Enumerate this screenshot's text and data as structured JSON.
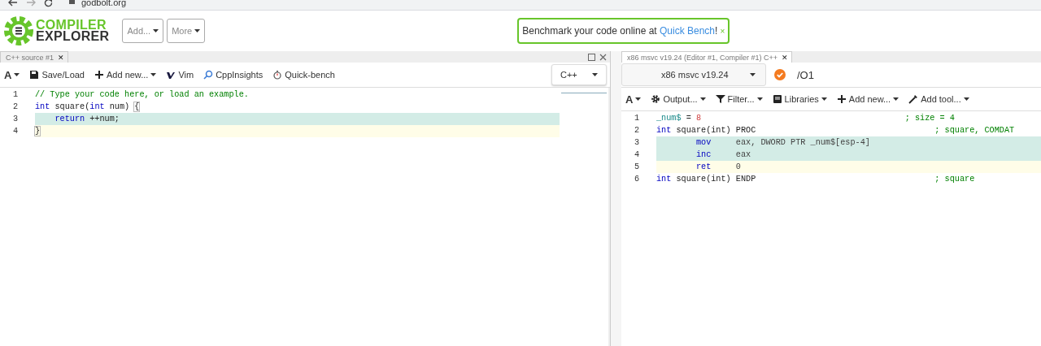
{
  "browser": {
    "address": "godbolt.org"
  },
  "header": {
    "logo_top": "COMPILER",
    "logo_bottom": "EXPLORER",
    "menus": [
      {
        "label": "Add...",
        "caret": true
      },
      {
        "label": "More",
        "caret": true
      }
    ],
    "banner": {
      "text": "Benchmark your code online at ",
      "link": "Quick Bench",
      "suffix": "!",
      "close": "×"
    }
  },
  "source_pane": {
    "tab": {
      "label": "C++ source #1",
      "close": "✕"
    },
    "toolbar": [
      {
        "kind": "font",
        "label": "A",
        "caret": true
      },
      {
        "kind": "save",
        "label": "Save/Load",
        "caret": false
      },
      {
        "kind": "add",
        "label": "Add new...",
        "caret": true
      },
      {
        "kind": "vim",
        "label": "Vim",
        "caret": false
      },
      {
        "kind": "insights",
        "label": "CppInsights",
        "caret": false
      },
      {
        "kind": "bench",
        "label": "Quick-bench",
        "caret": false
      }
    ],
    "language": "C++",
    "lines": [
      {
        "number": "1",
        "linked": false,
        "cursor": false,
        "tokens": [
          {
            "text": "// Type your code here, or load an example.",
            "kind": "comment"
          }
        ]
      },
      {
        "number": "2",
        "linked": false,
        "cursor": false,
        "tokens": [
          {
            "text": "int",
            "kind": "keyword"
          },
          {
            "text": " square(",
            "kind": "plain"
          },
          {
            "text": "int",
            "kind": "keyword"
          },
          {
            "text": " num) ",
            "kind": "plain"
          },
          {
            "text": "{",
            "kind": "bracket"
          }
        ]
      },
      {
        "number": "3",
        "linked": true,
        "cursor": false,
        "tokens": [
          {
            "text": "    return",
            "kind": "keyword"
          },
          {
            "text": " ++num;",
            "kind": "plain"
          }
        ]
      },
      {
        "number": "4",
        "linked": false,
        "cursor": true,
        "tokens": [
          {
            "text": "}",
            "kind": "bracket"
          }
        ]
      }
    ]
  },
  "compiler_pane": {
    "tab": {
      "label": "x86 msvc v19.24 (Editor #1, Compiler #1) C++",
      "close": "✕"
    },
    "compiler": "x86 msvc v19.24",
    "options": "/O1",
    "toolbar": [
      {
        "kind": "font",
        "label": "A",
        "caret": true
      },
      {
        "kind": "gear",
        "label": "Output...",
        "caret": true
      },
      {
        "kind": "filter",
        "label": "Filter...",
        "caret": true
      },
      {
        "kind": "book",
        "label": "Libraries",
        "caret": true
      },
      {
        "kind": "add",
        "label": "Add new...",
        "caret": true
      },
      {
        "kind": "tool",
        "label": "Add tool...",
        "caret": true
      }
    ],
    "lines": [
      {
        "number": "1",
        "linked": false,
        "cursor": false,
        "tokens": [
          {
            "text": "_num$",
            "kind": "label"
          },
          {
            "text": " = ",
            "kind": "plain"
          },
          {
            "text": "8",
            "kind": "number"
          },
          {
            "text": "                                         ; size = 4",
            "kind": "comment"
          }
        ]
      },
      {
        "number": "2",
        "linked": false,
        "cursor": false,
        "tokens": [
          {
            "text": "int",
            "kind": "keyword"
          },
          {
            "text": " square(int) PROC",
            "kind": "plain"
          },
          {
            "text": "                                    ; square, COMDAT",
            "kind": "comment"
          }
        ]
      },
      {
        "number": "3",
        "linked": true,
        "cursor": false,
        "tokens": [
          {
            "text": "        mov",
            "kind": "keyword"
          },
          {
            "text": "     eax, DWORD PTR _num$[esp-4]",
            "kind": "operand"
          }
        ]
      },
      {
        "number": "4",
        "linked": true,
        "cursor": false,
        "tokens": [
          {
            "text": "        inc",
            "kind": "keyword"
          },
          {
            "text": "     eax",
            "kind": "operand"
          }
        ]
      },
      {
        "number": "5",
        "linked": false,
        "cursor": true,
        "tokens": [
          {
            "text": "        ret",
            "kind": "keyword"
          },
          {
            "text": "     0",
            "kind": "operand"
          }
        ]
      },
      {
        "number": "6",
        "linked": false,
        "cursor": false,
        "tokens": [
          {
            "text": "int",
            "kind": "keyword"
          },
          {
            "text": " square(int) ENDP",
            "kind": "plain"
          },
          {
            "text": "                                    ; square",
            "kind": "comment"
          }
        ]
      }
    ]
  }
}
